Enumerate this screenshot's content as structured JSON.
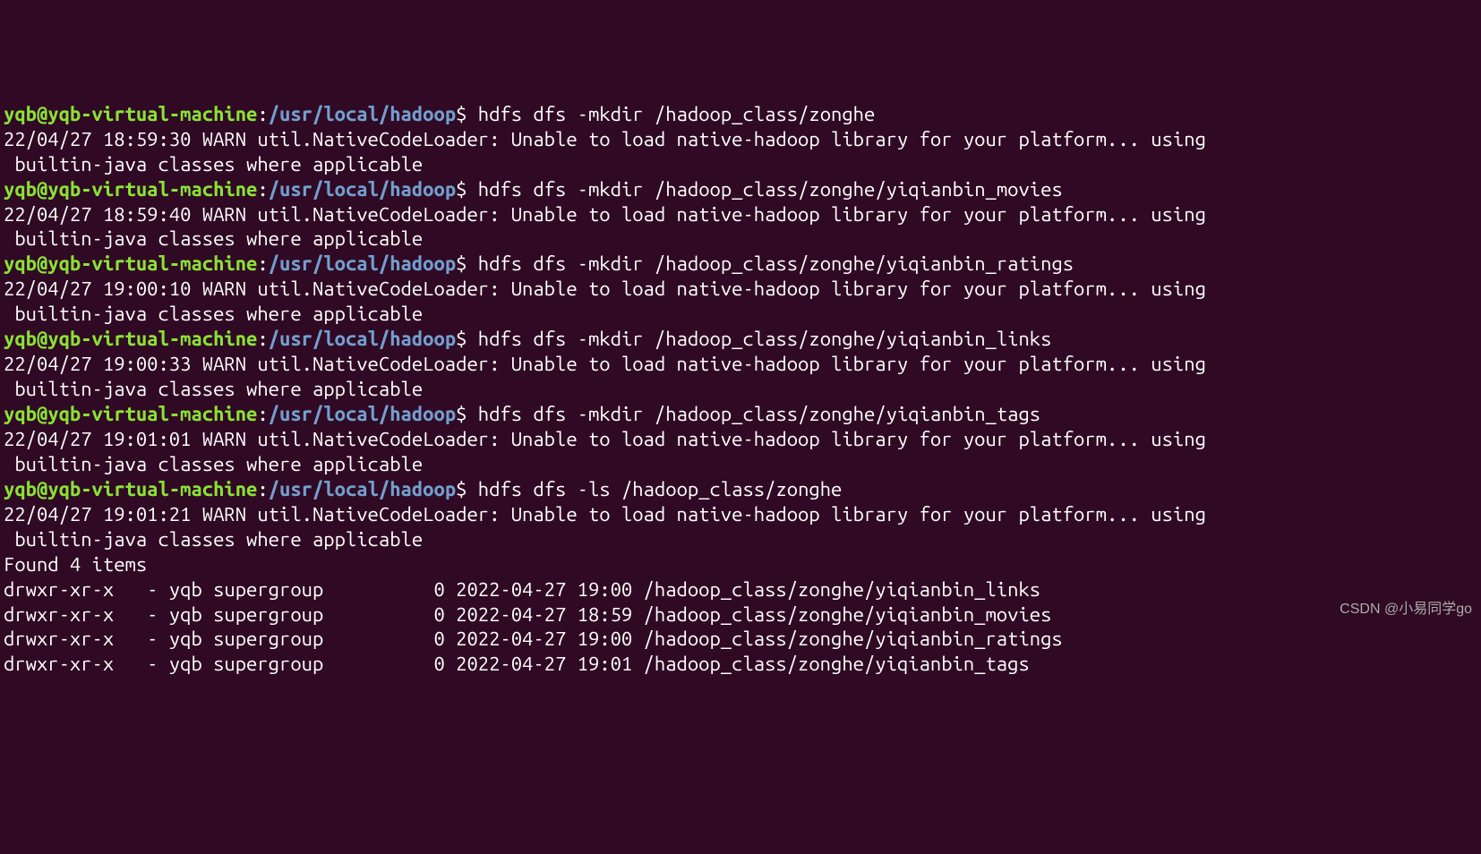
{
  "prompt": {
    "user_host": "yqb@yqb-virtual-machine",
    "colon": ":",
    "path": "/usr/local/hadoop",
    "dollar": "$"
  },
  "entries": [
    {
      "command": " hdfs dfs -mkdir /hadoop_class/zonghe",
      "output": "22/04/27 18:59:30 WARN util.NativeCodeLoader: Unable to load native-hadoop library for your platform... using\n builtin-java classes where applicable"
    },
    {
      "command": " hdfs dfs -mkdir /hadoop_class/zonghe/yiqianbin_movies",
      "output": "22/04/27 18:59:40 WARN util.NativeCodeLoader: Unable to load native-hadoop library for your platform... using\n builtin-java classes where applicable"
    },
    {
      "command": " hdfs dfs -mkdir /hadoop_class/zonghe/yiqianbin_ratings",
      "output": "22/04/27 19:00:10 WARN util.NativeCodeLoader: Unable to load native-hadoop library for your platform... using\n builtin-java classes where applicable"
    },
    {
      "command": " hdfs dfs -mkdir /hadoop_class/zonghe/yiqianbin_links",
      "output": "22/04/27 19:00:33 WARN util.NativeCodeLoader: Unable to load native-hadoop library for your platform... using\n builtin-java classes where applicable"
    },
    {
      "command": " hdfs dfs -mkdir /hadoop_class/zonghe/yiqianbin_tags",
      "output": "22/04/27 19:01:01 WARN util.NativeCodeLoader: Unable to load native-hadoop library for your platform... using\n builtin-java classes where applicable"
    },
    {
      "command": " hdfs dfs -ls /hadoop_class/zonghe",
      "output": "22/04/27 19:01:21 WARN util.NativeCodeLoader: Unable to load native-hadoop library for your platform... using\n builtin-java classes where applicable"
    }
  ],
  "ls_output": {
    "found": "Found 4 items",
    "rows": [
      "drwxr-xr-x   - yqb supergroup          0 2022-04-27 19:00 /hadoop_class/zonghe/yiqianbin_links",
      "drwxr-xr-x   - yqb supergroup          0 2022-04-27 18:59 /hadoop_class/zonghe/yiqianbin_movies",
      "drwxr-xr-x   - yqb supergroup          0 2022-04-27 19:00 /hadoop_class/zonghe/yiqianbin_ratings",
      "drwxr-xr-x   - yqb supergroup          0 2022-04-27 19:01 /hadoop_class/zonghe/yiqianbin_tags"
    ]
  },
  "watermark": "CSDN @小易同学go"
}
